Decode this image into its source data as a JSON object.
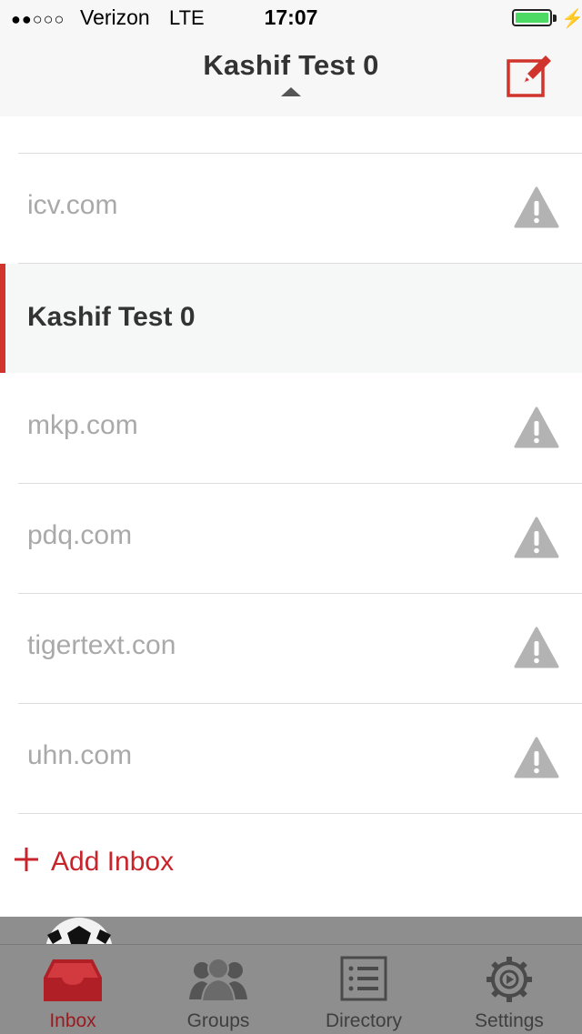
{
  "status_bar": {
    "signal": "●●○○○",
    "carrier": "Verizon",
    "network": "LTE",
    "time": "17:07",
    "battery_color": "#4cd964"
  },
  "header": {
    "title": "Kashif Test 0",
    "compose_icon": "compose-icon"
  },
  "inboxes": [
    {
      "label": "icv.com",
      "icon": "warning-icon",
      "active": false
    },
    {
      "label": "Kashif Test 0",
      "icon": "",
      "active": true
    },
    {
      "label": "mkp.com",
      "icon": "warning-icon",
      "active": false
    },
    {
      "label": "pdq.com",
      "icon": "warning-icon",
      "active": false
    },
    {
      "label": "tigertext.con",
      "icon": "warning-icon",
      "active": false
    },
    {
      "label": "uhn.com",
      "icon": "warning-icon",
      "active": false
    }
  ],
  "add_inbox": {
    "label": "Add Inbox",
    "icon": "plus-icon"
  },
  "tabs": [
    {
      "label": "Inbox",
      "icon": "inbox-tray-icon",
      "selected": true
    },
    {
      "label": "Groups",
      "icon": "group-icon",
      "selected": false
    },
    {
      "label": "Directory",
      "icon": "directory-list-icon",
      "selected": false
    },
    {
      "label": "Settings",
      "icon": "gear-icon",
      "selected": false
    }
  ],
  "colors": {
    "accent": "#c8242b",
    "active_row_bar": "#d0342c",
    "tabbar": "#8e8e8e",
    "muted_text": "#a9a9a9"
  }
}
